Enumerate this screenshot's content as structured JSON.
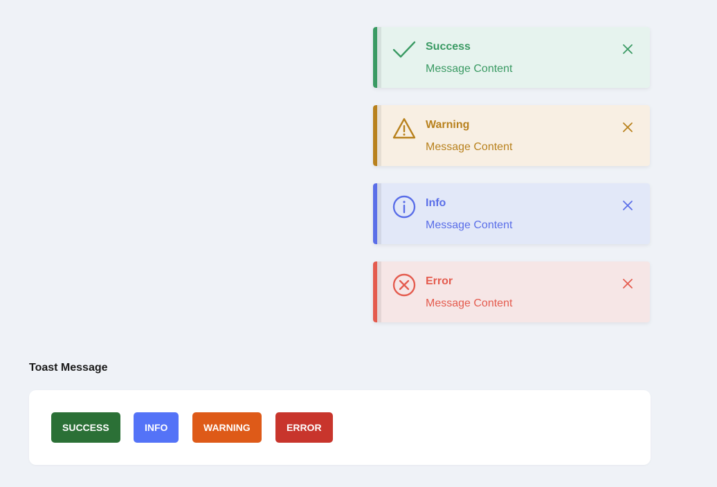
{
  "toasts": [
    {
      "type": "success",
      "title": "Success",
      "message": "Message Content",
      "icon": "check-icon",
      "color": "#3a9a63",
      "bg": "#e6f3ee"
    },
    {
      "type": "warning",
      "title": "Warning",
      "message": "Message Content",
      "icon": "warning-triangle-icon",
      "color": "#b8811d",
      "bg": "#f8efe3"
    },
    {
      "type": "info",
      "title": "Info",
      "message": "Message Content",
      "icon": "info-circle-icon",
      "color": "#5a6ee8",
      "bg": "#e2e8f8"
    },
    {
      "type": "error",
      "title": "Error",
      "message": "Message Content",
      "icon": "x-circle-icon",
      "color": "#e45b4e",
      "bg": "#f6e6e6"
    }
  ],
  "section": {
    "title": "Toast Message"
  },
  "buttons": [
    {
      "label": "SUCCESS",
      "color": "#2b7036"
    },
    {
      "label": "INFO",
      "color": "#5473f7"
    },
    {
      "label": "WARNING",
      "color": "#de5a18"
    },
    {
      "label": "ERROR",
      "color": "#c8352c"
    }
  ]
}
